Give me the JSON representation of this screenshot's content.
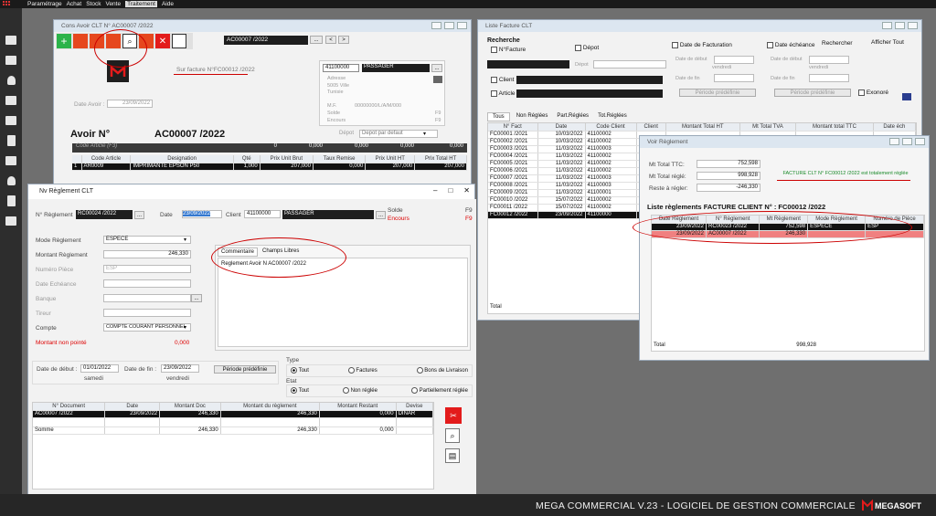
{
  "menu": {
    "items": [
      "Paramétrage",
      "Achat",
      "Stock",
      "Vente",
      "Traitement",
      "Aide"
    ]
  },
  "footer": {
    "title": "MEGA COMMERCIAL V.23 - LOGICIEL DE GESTION COMMERCIALE",
    "brand": "MEGASOFT"
  },
  "avoir": {
    "title": "Cons Avoir CLT N° AC00007 /2022",
    "nav_value": "AC00007 /2022",
    "sur_facture": "Sur facture N°FC00012 /2022",
    "date_label": "Date Avoir :",
    "date_value": "23/09/2022",
    "heading": "Avoir N°",
    "number": "AC00007 /2022",
    "client_code": "41100000",
    "client_name": "PASSAGER",
    "adresse_label": "Adresse",
    "adresse": "5005 Ville",
    "pays": "Tunisie",
    "mf_label": "M.F.",
    "mf_value": "00000000/L/A/M/000",
    "solde_label": "Solde",
    "solde_value": "F9",
    "encours_label": "Encours",
    "encours_value": "F9",
    "depot_label": "Dépot",
    "depot_value": "Depot par defaut",
    "code_label": "Code Article (F3)",
    "totals": [
      "0",
      "0,000",
      "0,000",
      "0,000",
      "0,000"
    ],
    "cols": [
      "Code Article",
      "Designation",
      "Qté",
      "Prix Unit Brut",
      "Taux Remise",
      "Prix Unit HT",
      "Prix Total HT"
    ],
    "row": {
      "num": "1",
      "code": "AR0009",
      "designation": "IMPRIMANTE EPSON P50",
      "qte": "1,000",
      "brut": "207,000",
      "remise": "0,000",
      "unit_ht": "207,000",
      "total_ht": "207,000"
    }
  },
  "liste": {
    "title": "Liste Facture CLT",
    "recherche": "Recherche",
    "nfacture": "N°Facture",
    "depot": "Dépot",
    "date_facturation": "Date de Facturation",
    "date_echeance": "Date échéance",
    "rechercher": "Rechercher",
    "afficher_tout": "Afficher Tout",
    "date_debut": "Date de début",
    "date_fin": "Date de fin",
    "vendredi": "vendredi",
    "periode": "Période prédéfinie",
    "client": "Client",
    "article": "Article",
    "exonore": "Exonoré",
    "tabs": [
      "Tous",
      "Non Réglées",
      "Part.Réglées",
      "Tot.Réglées"
    ],
    "cols": [
      "N° Fact",
      "Date",
      "Code Client",
      "Client",
      "Montant Total HT",
      "Mt Total TVA",
      "Montant total TTC",
      "Date éch"
    ],
    "rows": [
      [
        "FC00001 /2021",
        "10/03/2022",
        "41100002"
      ],
      [
        "FC00002 /2021",
        "10/03/2022",
        "41100002"
      ],
      [
        "FC00003 /2021",
        "11/03/2022",
        "41100003"
      ],
      [
        "FC00004 /2021",
        "11/03/2022",
        "41100002"
      ],
      [
        "FC00005 /2021",
        "11/03/2022",
        "41100002"
      ],
      [
        "FC00006 /2021",
        "11/03/2022",
        "41100002"
      ],
      [
        "FC00007 /2021",
        "11/03/2022",
        "41100003"
      ],
      [
        "FC00008 /2021",
        "11/03/2022",
        "41100003"
      ],
      [
        "FC00009 /2021",
        "11/03/2022",
        "41100001"
      ],
      [
        "FC00010 /2022",
        "15/07/2022",
        "41100002"
      ],
      [
        "FC00011 /2022",
        "15/07/2022",
        "41100002"
      ],
      [
        "FC00012 /2022",
        "23/09/2022",
        "41100000"
      ]
    ],
    "total": "Total"
  },
  "voir": {
    "title": "Voir Règlement",
    "mt_ttc_label": "Mt Total TTC:",
    "mt_ttc": "752,598",
    "mt_regle_label": "Mt Total réglé:",
    "mt_regle": "998,928",
    "reste_label": "Reste à régler:",
    "reste": "-246,330",
    "message": "FACTURE CLT N° FC00012 /2022 est totalement réglée",
    "liste_title": "Liste règlements FACTURE CLIENT N° : FC00012 /2022",
    "cols": [
      "Date Règlement",
      "N° Règlement",
      "Mt Règlement",
      "Mode Règlement",
      "Numéro de Pièce"
    ],
    "rows": [
      [
        "23/09/2022",
        "RC00023 /2022",
        "752,598",
        "ESPECE",
        "ESP"
      ],
      [
        "23/09/2022",
        "AC00007 /2022",
        "246,330",
        "",
        ""
      ]
    ],
    "total_label": "Total",
    "total": "998,928"
  },
  "reglement": {
    "title": "Nv Règlement CLT",
    "num_label": "N° Règlement",
    "num_value": "RC00024 /2022",
    "date_label": "Date",
    "date_value": "23/09/2022",
    "client_label": "Client",
    "client_code": "41100000",
    "client_name": "PASSAGER",
    "solde_label": "Solde",
    "solde_value": "F9",
    "encours_label": "Encours",
    "encours_value": "F9",
    "mode_label": "Mode Règlement",
    "mode_value": "ESPECE",
    "montant_label": "Montant Règlement",
    "montant_value": "246,330",
    "numero_piece_label": "Numéro Pièce",
    "numero_piece_value": "ESP",
    "date_echeance_label": "Date Echéance",
    "banque_label": "Banque",
    "tireur_label": "Tireur",
    "compte_label": "Compte",
    "compte_value": "COMPTE COURANT PERSONNEL",
    "non_pointe_label": "Montant non pointé",
    "non_pointe_value": "0,000",
    "tab_commentaire": "Commentaire",
    "tab_champs": "Champs Libres",
    "commentaire": "Reglement Avoir N AC00007 /2022",
    "date_debut_label": "Date de début :",
    "date_debut": "01/01/2022",
    "date_fin_label": "Date de fin :",
    "date_fin": "23/09/2022",
    "day_debut": "samedi",
    "day_fin": "vendredi",
    "periode": "Période prédéfinie",
    "type_label": "Type",
    "type_opts": [
      "Tout",
      "Factures",
      "Bons de Livraison"
    ],
    "etat_label": "Etat",
    "etat_opts": [
      "Tout",
      "Non réglée",
      "Partiellement réglée"
    ],
    "cols": [
      "N° Document",
      "Date",
      "Montant Doc",
      "Montant du règlement",
      "Montant Restant",
      "Devise"
    ],
    "row": [
      "AC00007 /2022",
      "23/09/2022",
      "246,330",
      "246,330",
      "0,000",
      "DINAR"
    ],
    "somme_label": "Somme",
    "somme": [
      "246,330",
      "246,330",
      "0,000"
    ]
  }
}
